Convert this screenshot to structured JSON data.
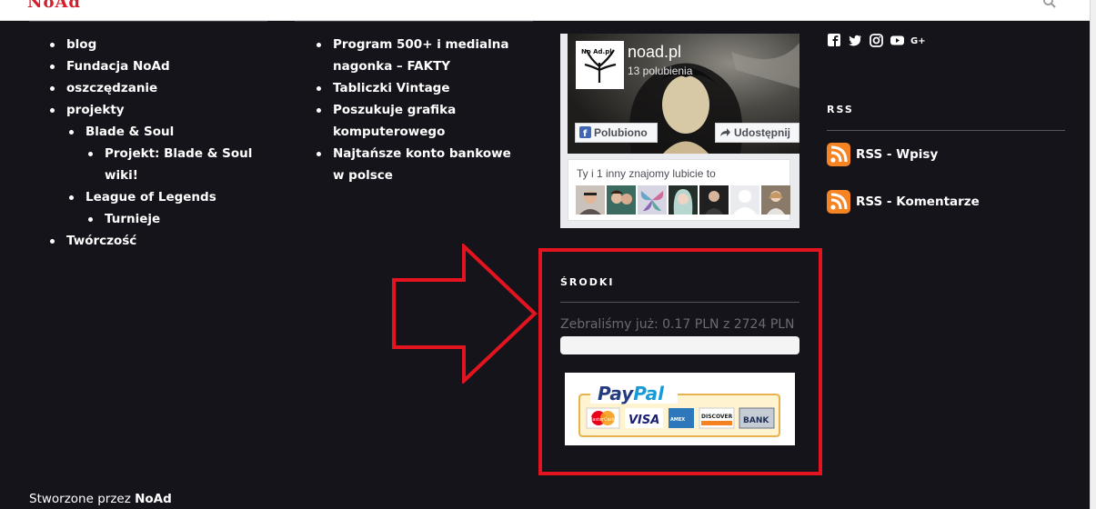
{
  "header": {
    "logo_text": "NoAd",
    "search_icon": "search-icon"
  },
  "menu_left": [
    {
      "label": "blog",
      "level": 0
    },
    {
      "label": "Fundacja NoAd",
      "level": 0
    },
    {
      "label": "oszczędzanie",
      "level": 0
    },
    {
      "label": "projekty",
      "level": 0
    },
    {
      "label": "Blade & Soul",
      "level": 1
    },
    {
      "label": "Projekt: Blade & Soul wiki!",
      "level": 2
    },
    {
      "label": "League of Legends",
      "level": 1
    },
    {
      "label": "Turnieje",
      "level": 2
    },
    {
      "label": "Twórczość",
      "level": 0
    }
  ],
  "recent_posts": [
    "Program 500+ i medialna nagonka – FAKTY",
    "Tabliczki Vintage",
    "Poszukuje grafika komputerowego",
    "Najtańsze konto bankowe w polsce"
  ],
  "facebook": {
    "page_name": "noad.pl",
    "likes_text": "13 polubienia",
    "avatar_text": "No Ad.pl",
    "like_button": "Polubiono",
    "share_button": "Udostępnij",
    "friends_text": "Ty i 1 inny znajomy lubicie to"
  },
  "social_icons": [
    "facebook-icon",
    "twitter-icon",
    "instagram-icon",
    "youtube-icon",
    "google-plus-icon"
  ],
  "rss": {
    "title": "RSS",
    "items": [
      "RSS - Wpisy",
      "RSS - Komentarze"
    ]
  },
  "funds": {
    "title": "ŚRODKI",
    "raised_text": "Zebraliśmy już: 0.17 PLN z 2724 PLN",
    "progress_fraction": 0.0001
  },
  "paypal": {
    "logo_text": "PayPal",
    "cards": [
      "MasterCard",
      "VISA",
      "AMEX",
      "DISCOVER",
      "BANK"
    ]
  },
  "footer": {
    "prefix": "Stworzone przez",
    "author": "NoAd"
  },
  "colors": {
    "highlight": "#e3141f",
    "background": "#15141b",
    "rss": "#f78422"
  }
}
